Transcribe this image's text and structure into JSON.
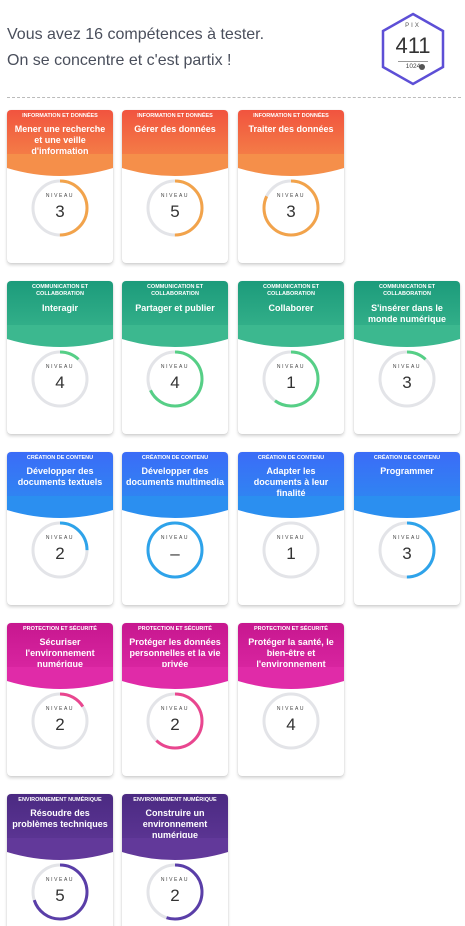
{
  "header": {
    "intro_line1": "Vous avez 16 compétences à tester.",
    "intro_line2": "On se concentre et c'est partix !",
    "pix_label": "PIX",
    "pix_score": "411",
    "pix_max": "1024",
    "accent_color": "#5d4fd6"
  },
  "level_label": "NIVEAU",
  "domain_colors": {
    "info": [
      "#f1543f",
      "#f58f4a"
    ],
    "com": [
      "#1c9b7b",
      "#3cb88f"
    ],
    "content": [
      "#3b6cf7",
      "#2b8ff0"
    ],
    "security": [
      "#c7178f",
      "#e02ba8"
    ],
    "env": [
      "#4b2a82",
      "#62399a"
    ]
  },
  "cards": [
    {
      "area": "INFORMATION ET DONNÉES",
      "title": "Mener une recherche et une veille d'information",
      "level": "3",
      "progress": 0.5,
      "arc_color": "#f2a34b",
      "domain": "info"
    },
    {
      "area": "INFORMATION ET DONNÉES",
      "title": "Gérer des données",
      "level": "5",
      "progress": 0.5,
      "arc_color": "#f2a34b",
      "domain": "info"
    },
    {
      "area": "INFORMATION ET DONNÉES",
      "title": "Traiter des données",
      "level": "3",
      "progress": 0.82,
      "arc_color": "#f2a34b",
      "domain": "info"
    },
    {
      "area": "COMMUNICATION ET COLLABORATION",
      "title": "Interagir",
      "level": "4",
      "progress": 0.12,
      "arc_color": "#56cf86",
      "domain": "com"
    },
    {
      "area": "COMMUNICATION ET COLLABORATION",
      "title": "Partager et publier",
      "level": "4",
      "progress": 0.68,
      "arc_color": "#56cf86",
      "domain": "com"
    },
    {
      "area": "COMMUNICATION ET COLLABORATION",
      "title": "Collaborer",
      "level": "1",
      "progress": 0.6,
      "arc_color": "#56cf86",
      "domain": "com"
    },
    {
      "area": "COMMUNICATION ET COLLABORATION",
      "title": "S'insérer dans le monde numérique",
      "level": "3",
      "progress": 0.12,
      "arc_color": "#56cf86",
      "domain": "com"
    },
    {
      "area": "CRÉATION DE CONTENU",
      "title": "Développer des documents textuels",
      "level": "2",
      "progress": 0.25,
      "arc_color": "#2ea3ea",
      "domain": "content"
    },
    {
      "area": "CRÉATION DE CONTENU",
      "title": "Développer des documents multimedia",
      "level": "–",
      "progress": 1.0,
      "arc_color": "#2ea3ea",
      "domain": "content"
    },
    {
      "area": "CRÉATION DE CONTENU",
      "title": "Adapter les documents à leur finalité",
      "level": "1",
      "progress": 0,
      "arc_color": "#2ea3ea",
      "domain": "content"
    },
    {
      "area": "CRÉATION DE CONTENU",
      "title": "Programmer",
      "level": "3",
      "progress": 0.5,
      "arc_color": "#2ea3ea",
      "domain": "content"
    },
    {
      "area": "PROTECTION ET SÉCURITÉ",
      "title": "Sécuriser l'environnement numérique",
      "level": "2",
      "progress": 0.16,
      "arc_color": "#e9468f",
      "domain": "security"
    },
    {
      "area": "PROTECTION ET SÉCURITÉ",
      "title": "Protéger les données personnelles et la vie privée",
      "level": "2",
      "progress": 0.62,
      "arc_color": "#e9468f",
      "domain": "security"
    },
    {
      "area": "PROTECTION ET SÉCURITÉ",
      "title": "Protéger la santé, le bien-être et l'environnement",
      "level": "4",
      "progress": 0,
      "arc_color": "#e9468f",
      "domain": "security"
    },
    {
      "area": "ENVIRONNEMENT NUMÉRIQUE",
      "title": "Résoudre des problèmes techniques",
      "level": "5",
      "progress": 0.7,
      "arc_color": "#5a3ea8",
      "domain": "env"
    },
    {
      "area": "ENVIRONNEMENT NUMÉRIQUE",
      "title": "Construire un environnement numérique",
      "level": "2",
      "progress": 0.55,
      "arc_color": "#5a3ea8",
      "domain": "env"
    }
  ]
}
